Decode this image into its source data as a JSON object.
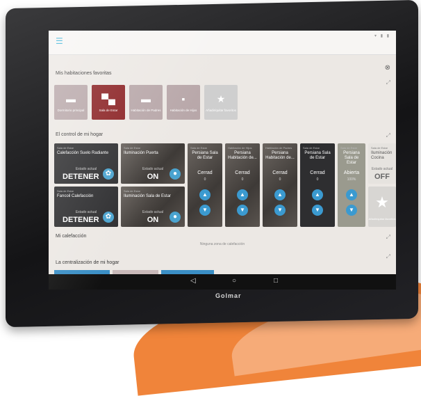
{
  "sections": {
    "favorites": "Mis habitaciones favoritas",
    "control": "El control de mi hogar",
    "heating": "Mi calefacción",
    "heating_empty": "Ninguna zona de calefacción",
    "centralization": "La centralización de mi hogar"
  },
  "favorites": [
    {
      "icon": "bed-icon",
      "label": "Dormitorio principal",
      "color": "#b8a7a9"
    },
    {
      "icon": "sofa-icon",
      "label": "Sala de Estar",
      "color": "#8a2022"
    },
    {
      "icon": "bed-icon",
      "label": "Habitación de Padres",
      "color": "#b8a7a9"
    },
    {
      "icon": "toilet-icon",
      "label": "Habitación de Hijos",
      "color": "#b8a7a9"
    },
    {
      "icon": "star-icon",
      "label": "Añadir/quitar favoritos",
      "color": "#cfcfcf"
    }
  ],
  "tiles": [
    {
      "room": "Sala de Estar",
      "name": "Calefacción Suelo Radiante",
      "state_label": "Estado actual",
      "state": "DETENER"
    },
    {
      "room": "Sala de Estar",
      "name": "Fancoil Calefacción",
      "state_label": "Estado actual",
      "state": "DETENER"
    },
    {
      "room": "Sala de Estar",
      "name": "Iluminación Puerta",
      "state_label": "Estado actual",
      "state": "ON"
    },
    {
      "room": "Sala de Estar",
      "name": "Iluminación Sala de Estar",
      "state_label": "Estado actual",
      "state": "ON"
    }
  ],
  "blinds": [
    {
      "room": "Sala de Estar",
      "name": "Persiana Sala de Estar",
      "state": "Cerrad",
      "pct": "0"
    },
    {
      "room": "Habitación de Hijos",
      "name": "Persiana Habitación de...",
      "state": "Cerrad",
      "pct": "0"
    },
    {
      "room": "Habitación de Padres",
      "name": "Persiana Habitación de...",
      "state": "Cerrad",
      "pct": "0"
    },
    {
      "room": "Sala de Estar",
      "name": "Persiana Sala de Estar",
      "state": "Cerrad",
      "pct": "0"
    },
    {
      "room": "Sala de Estar",
      "name": "Persiana Sala de Estar",
      "state": "Abierta",
      "pct": "100%"
    }
  ],
  "last_tile": {
    "room": "Sala de Estar",
    "name": "Iluminación Cocina",
    "state_label": "Estado actual",
    "state": "OFF"
  },
  "add_fav": "Añadir/quitar favoritos",
  "brand": "Golmar",
  "nav": {
    "back": "◁",
    "home": "○",
    "recent": "□"
  }
}
